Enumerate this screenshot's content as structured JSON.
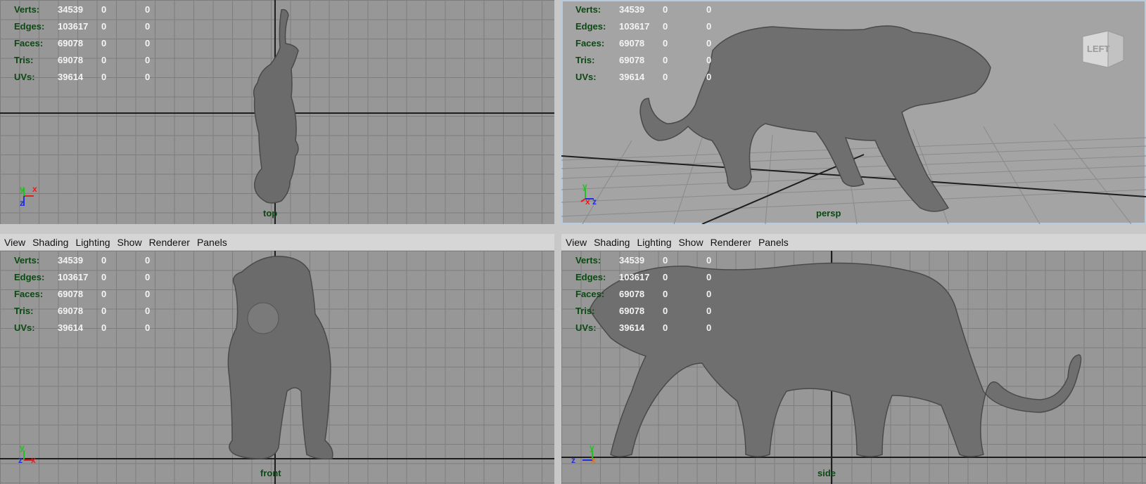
{
  "menu": [
    "View",
    "Shading",
    "Lighting",
    "Show",
    "Renderer",
    "Panels"
  ],
  "hud_labels": [
    "Verts:",
    "Edges:",
    "Faces:",
    "Tris:",
    "UVs:"
  ],
  "hud_values": [
    [
      "34539",
      "0",
      "0"
    ],
    [
      "103617",
      "0",
      "0"
    ],
    [
      "69078",
      "0",
      "0"
    ],
    [
      "69078",
      "0",
      "0"
    ],
    [
      "39614",
      "0",
      "0"
    ]
  ],
  "cameras": {
    "top": "top",
    "persp": "persp",
    "front": "front",
    "side": "side"
  },
  "viewcube_label": "LEFT",
  "axis_letters": {
    "x": "x",
    "y": "y",
    "z": "z"
  },
  "colors": {
    "hud_label": "#0a4a12",
    "hud_value": "#f4f4f4",
    "axis_x": "#e02020",
    "axis_y": "#20c020",
    "axis_z": "#2030e0"
  }
}
